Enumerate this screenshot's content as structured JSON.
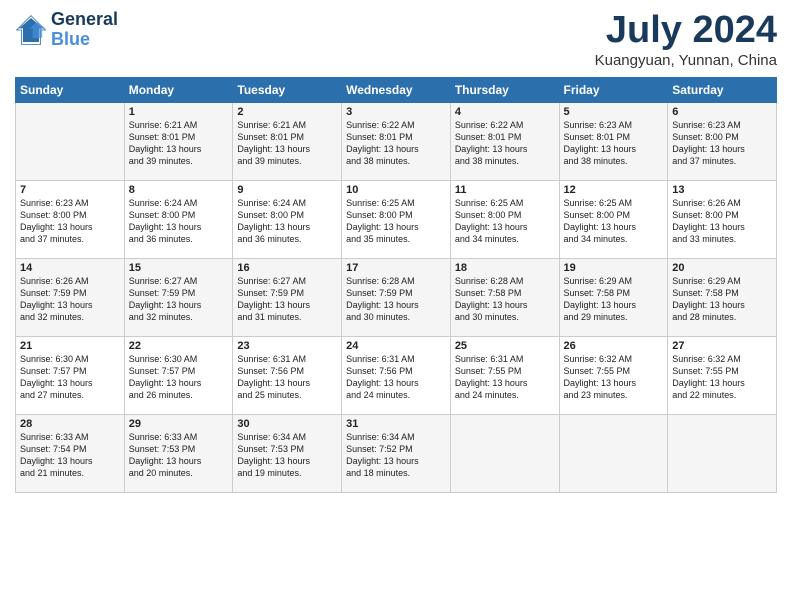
{
  "header": {
    "logo_line1": "General",
    "logo_line2": "Blue",
    "main_title": "July 2024",
    "subtitle": "Kuangyuan, Yunnan, China"
  },
  "days_of_week": [
    "Sunday",
    "Monday",
    "Tuesday",
    "Wednesday",
    "Thursday",
    "Friday",
    "Saturday"
  ],
  "weeks": [
    [
      {
        "day": "",
        "content": ""
      },
      {
        "day": "1",
        "content": "Sunrise: 6:21 AM\nSunset: 8:01 PM\nDaylight: 13 hours\nand 39 minutes."
      },
      {
        "day": "2",
        "content": "Sunrise: 6:21 AM\nSunset: 8:01 PM\nDaylight: 13 hours\nand 39 minutes."
      },
      {
        "day": "3",
        "content": "Sunrise: 6:22 AM\nSunset: 8:01 PM\nDaylight: 13 hours\nand 38 minutes."
      },
      {
        "day": "4",
        "content": "Sunrise: 6:22 AM\nSunset: 8:01 PM\nDaylight: 13 hours\nand 38 minutes."
      },
      {
        "day": "5",
        "content": "Sunrise: 6:23 AM\nSunset: 8:01 PM\nDaylight: 13 hours\nand 38 minutes."
      },
      {
        "day": "6",
        "content": "Sunrise: 6:23 AM\nSunset: 8:00 PM\nDaylight: 13 hours\nand 37 minutes."
      }
    ],
    [
      {
        "day": "7",
        "content": "Sunrise: 6:23 AM\nSunset: 8:00 PM\nDaylight: 13 hours\nand 37 minutes."
      },
      {
        "day": "8",
        "content": "Sunrise: 6:24 AM\nSunset: 8:00 PM\nDaylight: 13 hours\nand 36 minutes."
      },
      {
        "day": "9",
        "content": "Sunrise: 6:24 AM\nSunset: 8:00 PM\nDaylight: 13 hours\nand 36 minutes."
      },
      {
        "day": "10",
        "content": "Sunrise: 6:25 AM\nSunset: 8:00 PM\nDaylight: 13 hours\nand 35 minutes."
      },
      {
        "day": "11",
        "content": "Sunrise: 6:25 AM\nSunset: 8:00 PM\nDaylight: 13 hours\nand 34 minutes."
      },
      {
        "day": "12",
        "content": "Sunrise: 6:25 AM\nSunset: 8:00 PM\nDaylight: 13 hours\nand 34 minutes."
      },
      {
        "day": "13",
        "content": "Sunrise: 6:26 AM\nSunset: 8:00 PM\nDaylight: 13 hours\nand 33 minutes."
      }
    ],
    [
      {
        "day": "14",
        "content": "Sunrise: 6:26 AM\nSunset: 7:59 PM\nDaylight: 13 hours\nand 32 minutes."
      },
      {
        "day": "15",
        "content": "Sunrise: 6:27 AM\nSunset: 7:59 PM\nDaylight: 13 hours\nand 32 minutes."
      },
      {
        "day": "16",
        "content": "Sunrise: 6:27 AM\nSunset: 7:59 PM\nDaylight: 13 hours\nand 31 minutes."
      },
      {
        "day": "17",
        "content": "Sunrise: 6:28 AM\nSunset: 7:59 PM\nDaylight: 13 hours\nand 30 minutes."
      },
      {
        "day": "18",
        "content": "Sunrise: 6:28 AM\nSunset: 7:58 PM\nDaylight: 13 hours\nand 30 minutes."
      },
      {
        "day": "19",
        "content": "Sunrise: 6:29 AM\nSunset: 7:58 PM\nDaylight: 13 hours\nand 29 minutes."
      },
      {
        "day": "20",
        "content": "Sunrise: 6:29 AM\nSunset: 7:58 PM\nDaylight: 13 hours\nand 28 minutes."
      }
    ],
    [
      {
        "day": "21",
        "content": "Sunrise: 6:30 AM\nSunset: 7:57 PM\nDaylight: 13 hours\nand 27 minutes."
      },
      {
        "day": "22",
        "content": "Sunrise: 6:30 AM\nSunset: 7:57 PM\nDaylight: 13 hours\nand 26 minutes."
      },
      {
        "day": "23",
        "content": "Sunrise: 6:31 AM\nSunset: 7:56 PM\nDaylight: 13 hours\nand 25 minutes."
      },
      {
        "day": "24",
        "content": "Sunrise: 6:31 AM\nSunset: 7:56 PM\nDaylight: 13 hours\nand 24 minutes."
      },
      {
        "day": "25",
        "content": "Sunrise: 6:31 AM\nSunset: 7:55 PM\nDaylight: 13 hours\nand 24 minutes."
      },
      {
        "day": "26",
        "content": "Sunrise: 6:32 AM\nSunset: 7:55 PM\nDaylight: 13 hours\nand 23 minutes."
      },
      {
        "day": "27",
        "content": "Sunrise: 6:32 AM\nSunset: 7:55 PM\nDaylight: 13 hours\nand 22 minutes."
      }
    ],
    [
      {
        "day": "28",
        "content": "Sunrise: 6:33 AM\nSunset: 7:54 PM\nDaylight: 13 hours\nand 21 minutes."
      },
      {
        "day": "29",
        "content": "Sunrise: 6:33 AM\nSunset: 7:53 PM\nDaylight: 13 hours\nand 20 minutes."
      },
      {
        "day": "30",
        "content": "Sunrise: 6:34 AM\nSunset: 7:53 PM\nDaylight: 13 hours\nand 19 minutes."
      },
      {
        "day": "31",
        "content": "Sunrise: 6:34 AM\nSunset: 7:52 PM\nDaylight: 13 hours\nand 18 minutes."
      },
      {
        "day": "",
        "content": ""
      },
      {
        "day": "",
        "content": ""
      },
      {
        "day": "",
        "content": ""
      }
    ]
  ]
}
